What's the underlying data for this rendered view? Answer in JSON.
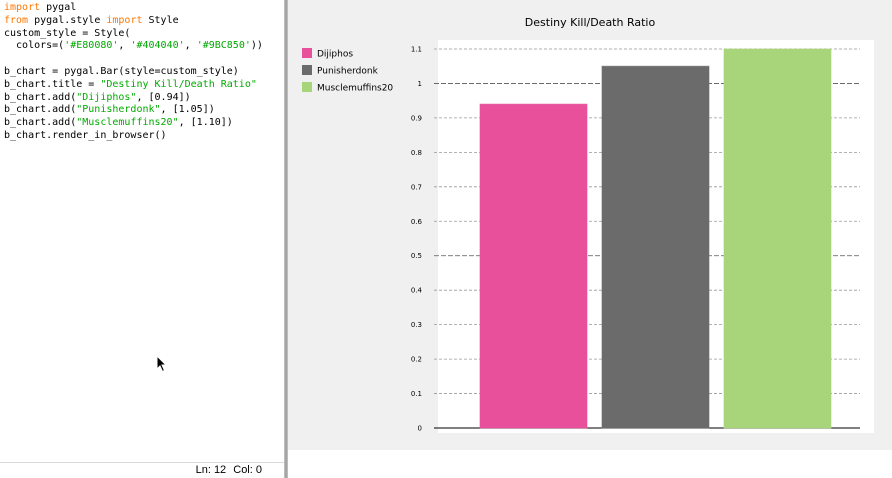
{
  "editor": {
    "lines": [
      {
        "text": "",
        "parts": [
          {
            "t": "import",
            "c": "kw"
          },
          {
            "t": " pygal",
            "c": ""
          }
        ]
      },
      {
        "text": "",
        "parts": [
          {
            "t": "from",
            "c": "kw"
          },
          {
            "t": " pygal.style ",
            "c": ""
          },
          {
            "t": "import",
            "c": "kw"
          },
          {
            "t": " Style",
            "c": ""
          }
        ]
      },
      {
        "text": "",
        "parts": [
          {
            "t": "custom_style = Style(",
            "c": ""
          }
        ]
      },
      {
        "text": "",
        "parts": [
          {
            "t": "  colors=(",
            "c": ""
          },
          {
            "t": "'#E80080'",
            "c": "str"
          },
          {
            "t": ", ",
            "c": ""
          },
          {
            "t": "'#404040'",
            "c": "str"
          },
          {
            "t": ", ",
            "c": ""
          },
          {
            "t": "'#9BC850'",
            "c": "str"
          },
          {
            "t": "))",
            "c": ""
          }
        ]
      },
      {
        "text": "",
        "parts": []
      },
      {
        "text": "",
        "parts": [
          {
            "t": "b_chart = pygal.Bar(style=custom_style)",
            "c": ""
          }
        ]
      },
      {
        "text": "",
        "parts": [
          {
            "t": "b_chart.title = ",
            "c": ""
          },
          {
            "t": "\"Destiny Kill/Death Ratio\"",
            "c": "str"
          }
        ]
      },
      {
        "text": "",
        "parts": [
          {
            "t": "b_chart.add(",
            "c": ""
          },
          {
            "t": "\"Dijiphos\"",
            "c": "str"
          },
          {
            "t": ", [0.94])",
            "c": ""
          }
        ]
      },
      {
        "text": "",
        "parts": [
          {
            "t": "b_chart.add(",
            "c": ""
          },
          {
            "t": "\"Punisherdonk\"",
            "c": "str"
          },
          {
            "t": ", [1.05])",
            "c": ""
          }
        ]
      },
      {
        "text": "",
        "parts": [
          {
            "t": "b_chart.add(",
            "c": ""
          },
          {
            "t": "\"Musclemuffins20\"",
            "c": "str"
          },
          {
            "t": ", [1.10])",
            "c": ""
          }
        ]
      },
      {
        "text": "",
        "parts": [
          {
            "t": "b_chart.render_in_browser()",
            "c": ""
          }
        ]
      }
    ],
    "status": {
      "line": "Ln: 12",
      "col": "Col: 0"
    },
    "colors": {
      "keyword": "#ff7700",
      "string": "#00aa00"
    }
  },
  "chart_data": {
    "type": "bar",
    "title": "Destiny Kill/Death Ratio",
    "xlabel": "",
    "ylabel": "",
    "ylim": [
      0,
      1.1
    ],
    "yticks": [
      "0",
      "0.1",
      "0.2",
      "0.3",
      "0.4",
      "0.5",
      "0.6",
      "0.7",
      "0.8",
      "0.9",
      "1",
      "1.1"
    ],
    "ytick_values": [
      0,
      0.1,
      0.2,
      0.3,
      0.4,
      0.5,
      0.6,
      0.7,
      0.8,
      0.9,
      1.0,
      1.1
    ],
    "grid": true,
    "legend_position": "top-left",
    "series": [
      {
        "name": "Dijiphos",
        "values": [
          0.94
        ],
        "color": "#E8509B"
      },
      {
        "name": "Punisherdonk",
        "values": [
          1.05
        ],
        "color": "#6B6B6B"
      },
      {
        "name": "Musclemuffins20",
        "values": [
          1.1
        ],
        "color": "#A8D47A"
      }
    ]
  }
}
